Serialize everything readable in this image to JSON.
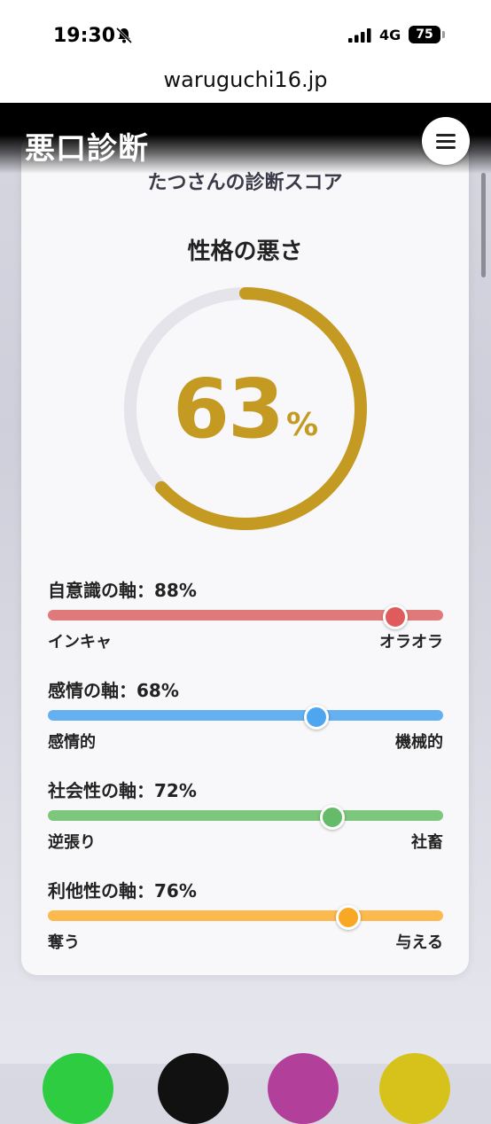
{
  "status": {
    "time": "19:30",
    "network": "4G",
    "battery": "75"
  },
  "browser": {
    "url": "waruguchi16.jp"
  },
  "header": {
    "logo": "悪口診断"
  },
  "card": {
    "subtitle": "たつさんの診断スコア",
    "gauge": {
      "title": "性格の悪さ",
      "value": "63",
      "unit": "%",
      "fraction": 0.63,
      "color": "#c49a22",
      "track_color": "#e4e4ea"
    },
    "axes": [
      {
        "label": "自意識の軸：88%",
        "value": 0.88,
        "left": "インキャ",
        "right": "オラオラ",
        "color": "#e07a7a",
        "knob": "#e05c5c"
      },
      {
        "label": "感情の軸：68%",
        "value": 0.68,
        "left": "感情的",
        "right": "機械的",
        "color": "#64b0f0",
        "knob": "#4fa6f0"
      },
      {
        "label": "社会性の軸：72%",
        "value": 0.72,
        "left": "逆張り",
        "right": "社畜",
        "color": "#7cc77c",
        "knob": "#66bb6a"
      },
      {
        "label": "利他性の軸：76%",
        "value": 0.76,
        "left": "奪う",
        "right": "与える",
        "color": "#fbb94e",
        "knob": "#f9a825"
      }
    ]
  },
  "bottom_circles": [
    "#2ecc40",
    "#111111",
    "#b2409a",
    "#d6c21a"
  ]
}
